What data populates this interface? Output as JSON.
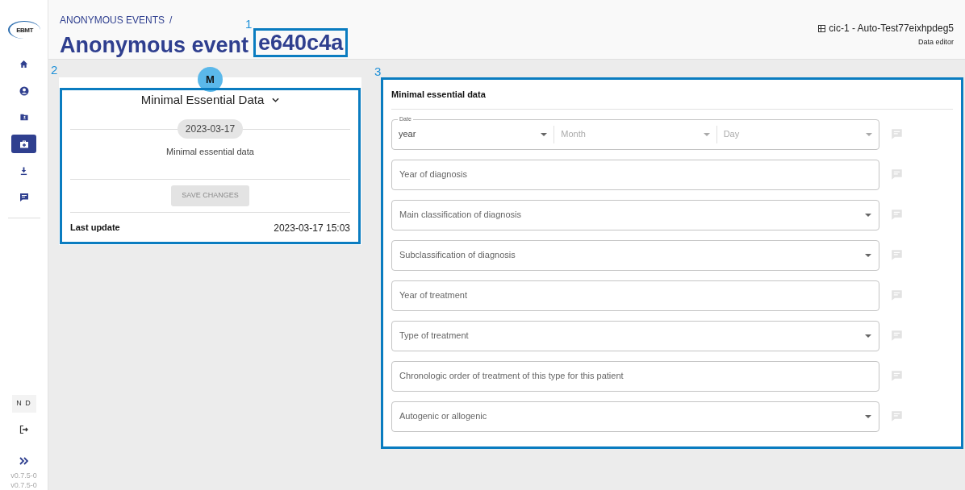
{
  "sidebar": {
    "logo": "EBMT",
    "items": [
      {
        "selected": false
      },
      {
        "selected": false
      },
      {
        "selected": false
      },
      {
        "selected": true
      },
      {
        "selected": false
      },
      {
        "selected": false
      }
    ],
    "user_initials": "N D",
    "versions": [
      "v0.7.5-0",
      "v0.7.5-0"
    ]
  },
  "header": {
    "breadcrumb": "ANONYMOUS EVENTS",
    "breadcrumb_separator": "/",
    "title": "Anonymous event",
    "title_id": "e640c4a",
    "title_annotation": "1",
    "center": "cic-1 - Auto-Test77eixhpdeg5",
    "role": "Data editor"
  },
  "event_card": {
    "badge": "M",
    "annotation": "2",
    "title": "Minimal Essential Data",
    "date": "2023-03-17",
    "form_name": "Minimal essential data",
    "save_button": {
      "label": "SAVE CHANGES",
      "disabled": true
    },
    "last_update_label": "Last update",
    "last_update": "2023-03-17 15:03"
  },
  "form": {
    "annotation": "3",
    "title": "Minimal essential data",
    "fields": [
      {
        "kind": "date",
        "label": "Date",
        "parts": [
          {
            "placeholder": "year",
            "selected": true
          },
          {
            "placeholder": "Month",
            "selected": false
          },
          {
            "placeholder": "Day",
            "selected": false
          }
        ]
      },
      {
        "kind": "text",
        "placeholder": "Year of diagnosis"
      },
      {
        "kind": "select",
        "placeholder": "Main classification of diagnosis"
      },
      {
        "kind": "select",
        "placeholder": "Subclassification of diagnosis"
      },
      {
        "kind": "text",
        "placeholder": "Year of treatment"
      },
      {
        "kind": "select",
        "placeholder": "Type of treatment"
      },
      {
        "kind": "text",
        "placeholder": "Chronologic order of treatment of this type for this patient"
      },
      {
        "kind": "select",
        "placeholder": "Autogenic or allogenic"
      }
    ]
  }
}
